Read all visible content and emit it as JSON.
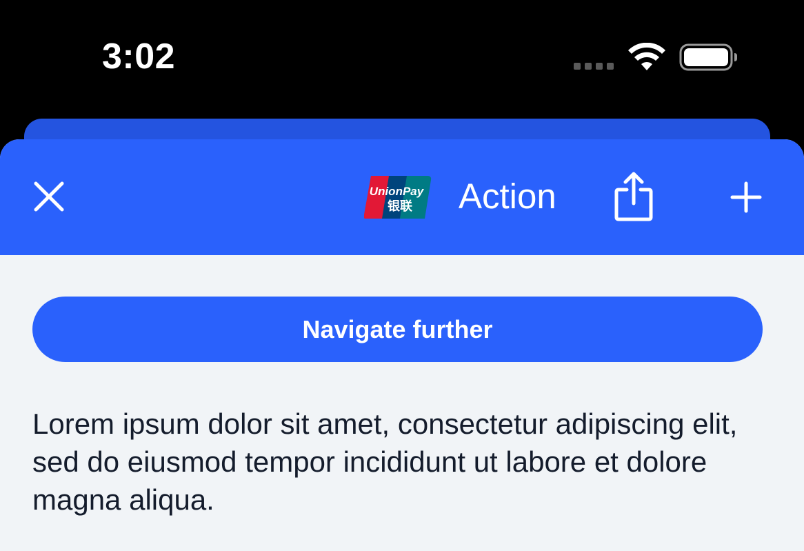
{
  "status_bar": {
    "time": "3:02"
  },
  "nav_bar": {
    "title": "Action",
    "logo_text_top": "UnionPay",
    "logo_text_bottom": "银联",
    "close_icon": "close-icon",
    "share_icon": "share-icon",
    "add_icon": "plus-icon"
  },
  "content": {
    "primary_button_label": "Navigate further",
    "body_text": "Lorem ipsum dolor sit amet, consectetur adipiscing elit, sed do eiusmod tempor incididunt ut labore et dolore magna aliqua."
  },
  "colors": {
    "accent": "#2a61fc",
    "background": "#f1f4f7",
    "text": "#141c2c",
    "status_bar": "#000000"
  }
}
